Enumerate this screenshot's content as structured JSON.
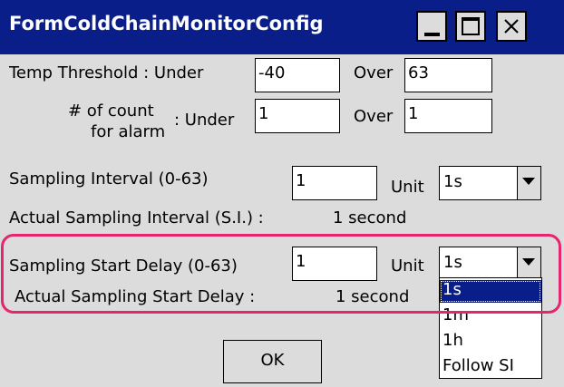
{
  "window": {
    "title": "FormColdChainMonitorConfig",
    "title_bar_color": "#0a1e8a",
    "controls": [
      "minimize-icon",
      "maximize-icon",
      "close-icon"
    ]
  },
  "temp_threshold": {
    "label": "Temp Threshold",
    "under_label": ": Under",
    "under_value": "-40",
    "over_label": "Over",
    "over_value": "63"
  },
  "alarm_count": {
    "label_line1": "# of count",
    "label_line2": "for alarm",
    "under_label": ": Under",
    "under_value": "1",
    "over_label": "Over",
    "over_value": "1"
  },
  "sampling_interval": {
    "label": "Sampling Interval (0-63)",
    "value": "1",
    "unit_label": "Unit",
    "unit_value": "1s",
    "actual_label": "Actual Sampling Interval (S.I.) :",
    "actual_value": "1 second"
  },
  "sampling_start_delay": {
    "label": "Sampling Start Delay (0-63)",
    "value": "1",
    "unit_label": "Unit",
    "unit_value": "1s",
    "actual_label": "Actual Sampling Start Delay :",
    "actual_value": "1 second",
    "dropdown_options": [
      "1s",
      "1m",
      "1h",
      "Follow SI"
    ],
    "selected_option": "1s"
  },
  "highlight_color": "#e5266e",
  "ok_label": "OK"
}
